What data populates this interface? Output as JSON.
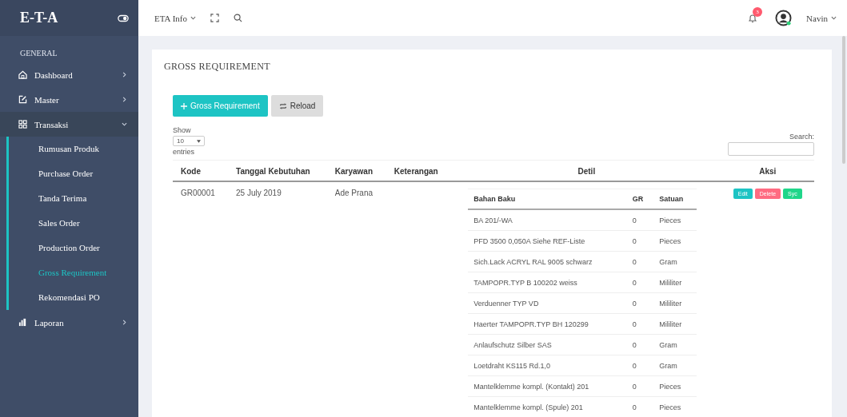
{
  "sidebar": {
    "logo": "E-T-A",
    "section": "GENERAL",
    "items": [
      {
        "label": "Dashboard",
        "expanded": false
      },
      {
        "label": "Master",
        "expanded": false
      },
      {
        "label": "Transaksi",
        "expanded": true,
        "children": [
          {
            "label": "Rumusan Produk",
            "selected": false
          },
          {
            "label": "Purchase Order",
            "selected": false
          },
          {
            "label": "Tanda Terima",
            "selected": false
          },
          {
            "label": "Sales Order",
            "selected": false
          },
          {
            "label": "Production Order",
            "selected": false
          },
          {
            "label": "Gross Requirement",
            "selected": true
          },
          {
            "label": "Rekomendasi PO",
            "selected": false
          }
        ]
      },
      {
        "label": "Laporan",
        "expanded": false
      }
    ]
  },
  "topbar": {
    "menu": "ETA Info",
    "notifications": "3",
    "user": "Navin"
  },
  "card": {
    "title": "GROSS REQUIREMENT",
    "buttons": [
      {
        "label": "Gross Requirement",
        "kind": "primary"
      },
      {
        "label": "Reload",
        "kind": "secondary"
      }
    ],
    "show_label": "Show",
    "page_size": "10",
    "entries_label": "entries",
    "search_label": "Search:"
  },
  "table": {
    "columns": [
      "Kode",
      "Tanggal Kebutuhan",
      "Karyawan",
      "Keterangan",
      "Detil",
      "Aksi"
    ],
    "rows": [
      {
        "kode": "GR00001",
        "tanggal": "25 July 2019",
        "karyawan": "Ade Prana",
        "detail_columns": [
          "Bahan Baku",
          "GR",
          "Satuan"
        ],
        "detail_rows": [
          [
            "BA 201/-WA",
            "0",
            "Pieces"
          ],
          [
            "PFD 3500 0,050A Siehe REF-Liste",
            "0",
            "Pieces"
          ],
          [
            "Sich.Lack ACRYL RAL 9005 schwarz",
            "0",
            "Gram"
          ],
          [
            "TAMPOPR.TYP B 100202 weiss",
            "0",
            "Mililiter"
          ],
          [
            "Verduenner TYP VD",
            "0",
            "Mililiter"
          ],
          [
            "Haerter TAMPOPR.TYP BH 120299",
            "0",
            "Mililiter"
          ],
          [
            "Anlaufschutz Silber SAS",
            "0",
            "Gram"
          ],
          [
            "Loetdraht KS115 Rd.1,0",
            "0",
            "Gram"
          ],
          [
            "Mantelklemme kompl. (Kontakt) 201",
            "0",
            "Pieces"
          ],
          [
            "Mantelklemme kompl. (Spule) 201",
            "0",
            "Pieces"
          ]
        ],
        "actions": [
          {
            "label": "Edit",
            "kind": "edit"
          },
          {
            "label": "Delete",
            "kind": "delete"
          },
          {
            "label": "Syc",
            "kind": "sync"
          }
        ]
      }
    ]
  }
}
